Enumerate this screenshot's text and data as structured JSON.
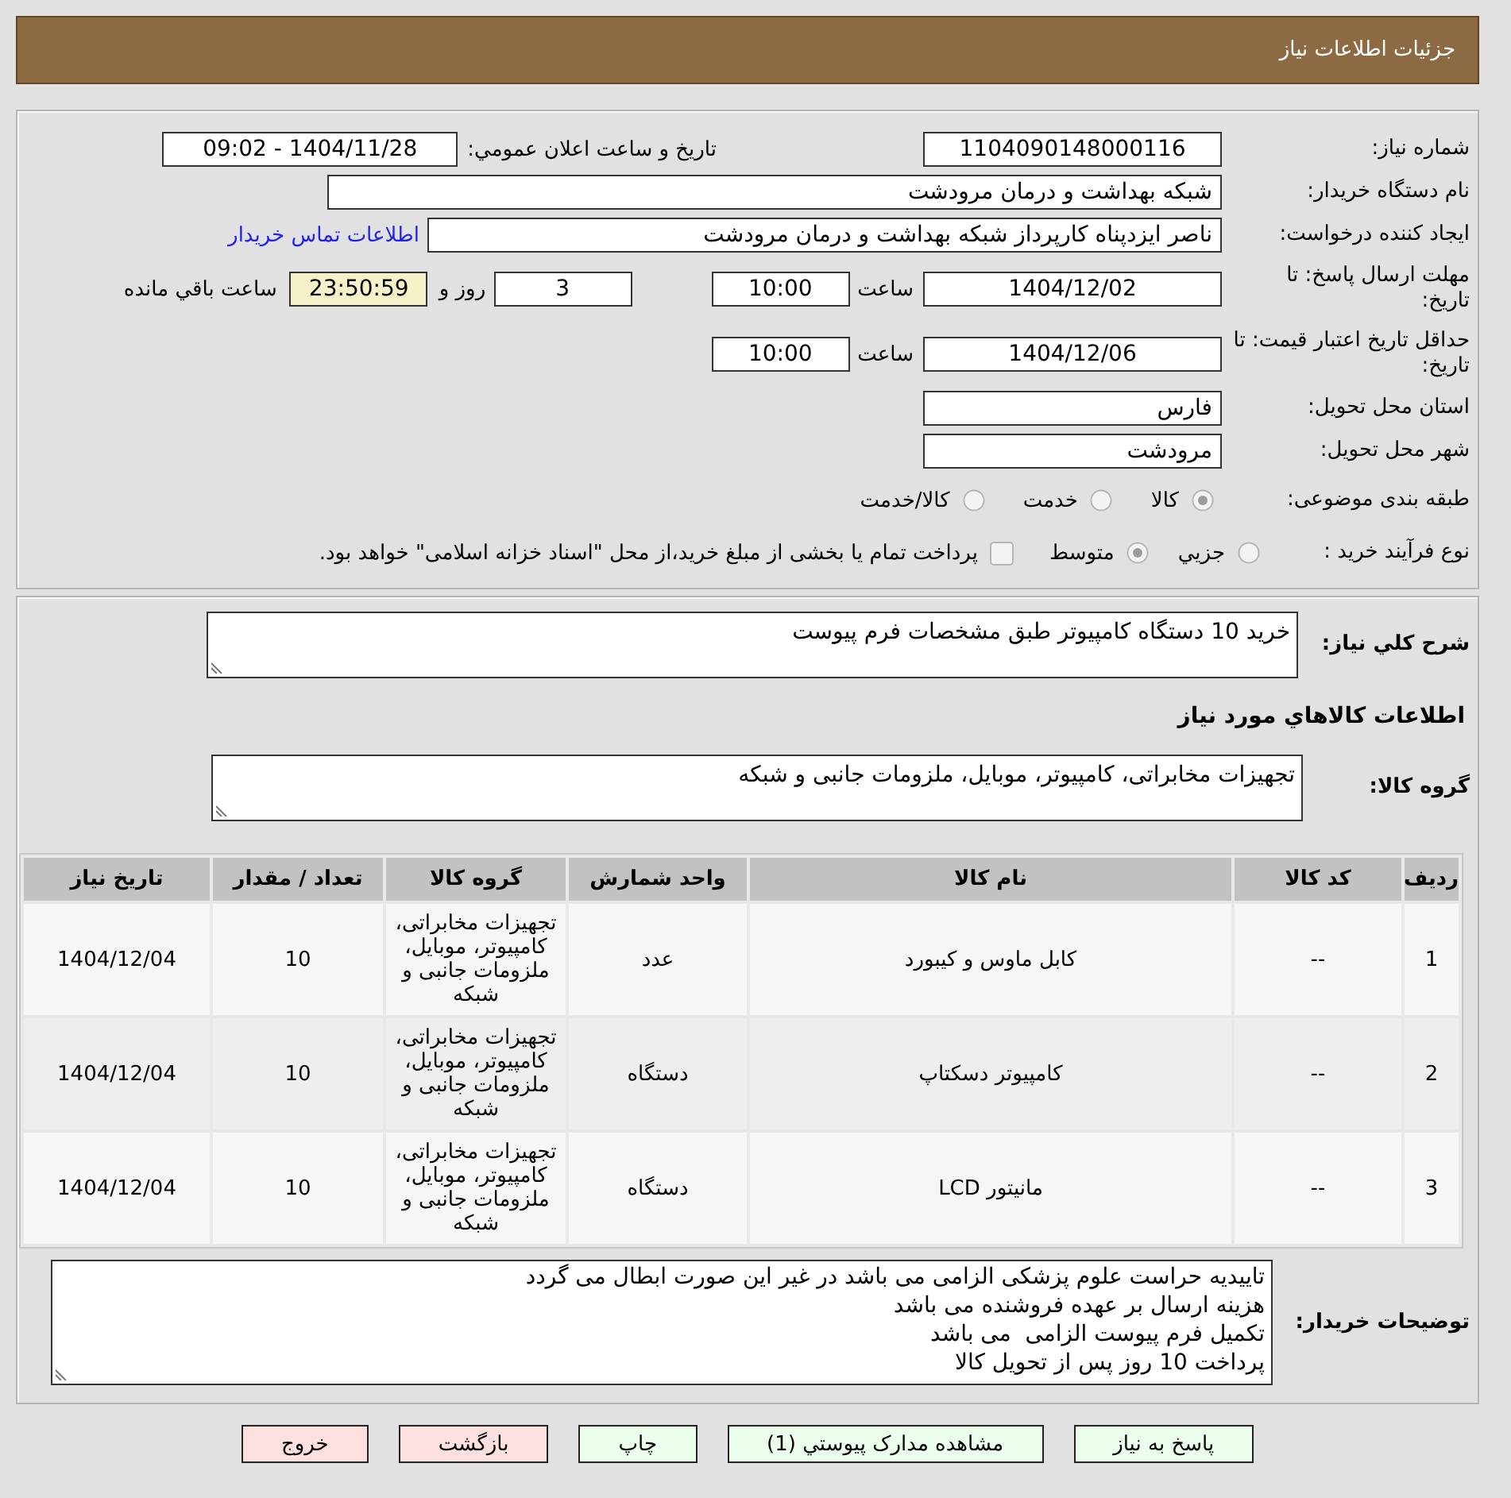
{
  "header": {
    "title": "جزئیات اطلاعات نیاز"
  },
  "summary": {
    "need_number": {
      "label": "شماره نیاز:",
      "value": "1104090148000116"
    },
    "announced": {
      "label": "تاریخ و ساعت اعلان عمومي:",
      "value": "1404/11/28 - 09:02"
    },
    "buyer_org": {
      "label": "نام دستگاه خریدار:",
      "value": "شبکه بهداشت و درمان مرودشت"
    },
    "requester": {
      "label": "ایجاد کننده درخواست:",
      "value": "ناصر ایزدپناه کارپرداز شبکه بهداشت و درمان مرودشت",
      "contact_link": "اطلاعات تماس خریدار"
    },
    "reply_deadline": {
      "label": "مهلت ارسال پاسخ: تا تاریخ:",
      "date": "1404/12/02",
      "time_label": "ساعت",
      "time": "10:00",
      "days": "3",
      "days_label": "روز و",
      "remaining": "23:50:59",
      "remaining_label": "ساعت باقي مانده"
    },
    "price_validity": {
      "label": "حداقل تاریخ اعتبار قیمت: تا تاریخ:",
      "date": "1404/12/06",
      "time_label": "ساعت",
      "time": "10:00"
    },
    "province": {
      "label": "استان محل تحویل:",
      "value": "فارس"
    },
    "city": {
      "label": "شهر محل تحویل:",
      "value": "مرودشت"
    },
    "category": {
      "label": "طبقه بندی موضوعی:",
      "options": [
        {
          "label": "کالا",
          "selected": true
        },
        {
          "label": "خدمت",
          "selected": false
        },
        {
          "label": "کالا/خدمت",
          "selected": false
        }
      ]
    },
    "purchase_process": {
      "label": "نوع فرآیند خرید :",
      "options": [
        {
          "label": "جزيي",
          "selected": false
        },
        {
          "label": "متوسط",
          "selected": true
        }
      ],
      "treasury_payment": {
        "label": "پرداخت تمام یا بخشی از مبلغ خرید،از محل \"اسناد خزانه اسلامی\" خواهد بود.",
        "checked": false
      }
    }
  },
  "need_description": {
    "label": "شرح کلي نیاز:",
    "value": "خرید 10 دستگاه کامپیوتر طبق مشخصات فرم پیوست"
  },
  "goods_section_title": "اطلاعات کالاهاي مورد نیاز",
  "goods_group": {
    "label": "گروه کالا:",
    "value": "تجهیزات مخابراتی، کامپیوتر، موبایل، ملزومات جانبی و شبکه"
  },
  "goods_table": {
    "columns": [
      "ردیف",
      "کد کالا",
      "نام کالا",
      "واحد شمارش",
      "گروه کالا",
      "تعداد / مقدار",
      "تاریخ نیاز"
    ],
    "rows": [
      {
        "cells": [
          "1",
          "--",
          "کابل ماوس و کیبورد",
          "عدد",
          "تجهیزات مخابراتی، کامپیوتر، موبایل، ملزومات جانبی و شبکه",
          "10",
          "1404/12/04"
        ]
      },
      {
        "cells": [
          "2",
          "--",
          "کامپیوتر دسکتاپ",
          "دستگاه",
          "تجهیزات مخابراتی، کامپیوتر، موبایل، ملزومات جانبی و شبکه",
          "10",
          "1404/12/04"
        ]
      },
      {
        "cells": [
          "3",
          "--",
          "مانیتور LCD",
          "دستگاه",
          "تجهیزات مخابراتی، کامپیوتر، موبایل، ملزومات جانبی و شبکه",
          "10",
          "1404/12/04"
        ]
      }
    ]
  },
  "buyer_notes": {
    "label": "توضیحات خریدار:",
    "value": "تاییدیه حراست علوم پزشکی الزامی می باشد در غیر این صورت ابطال می گردد\nهزینه ارسال بر عهده فروشنده می باشد\nتکمیل فرم پیوست الزامی  می باشد\nپرداخت 10 روز پس از تحویل کالا"
  },
  "buttons": [
    {
      "label": "پاسخ به نیاز",
      "kind": "action"
    },
    {
      "label": "مشاهده مدارک پیوستي (1)",
      "kind": "action"
    },
    {
      "label": "چاپ",
      "kind": "action"
    },
    {
      "label": "بازگشت",
      "kind": "leave"
    },
    {
      "label": "خروج",
      "kind": "leave"
    }
  ]
}
